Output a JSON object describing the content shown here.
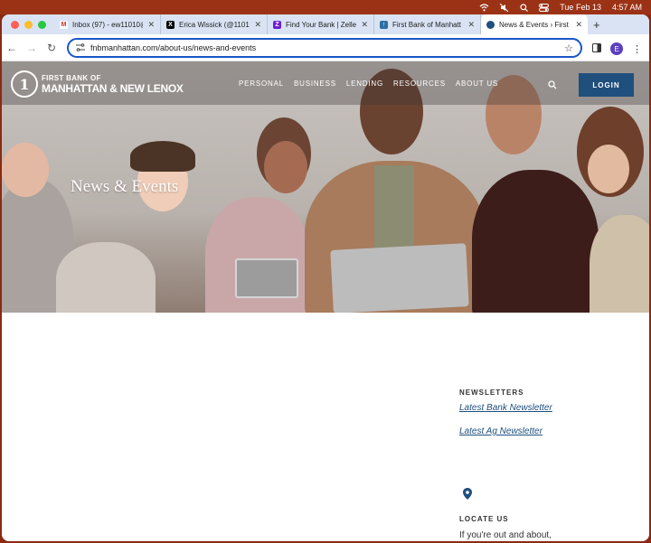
{
  "menubar": {
    "datetime_day": "Tue Feb 13",
    "datetime_time": "4:57 AM"
  },
  "tabs": [
    {
      "title": "Inbox (97) - ew11010@",
      "favicon": "gmail-icon",
      "color": "#d93025"
    },
    {
      "title": "Erica Wissick (@11010",
      "favicon": "x-icon",
      "color": "#000000"
    },
    {
      "title": "Find Your Bank | Zelle",
      "favicon": "zelle-icon",
      "color": "#6d1ed4"
    },
    {
      "title": "First Bank of Manhatt",
      "favicon": "bank-icon",
      "color": "#2d6fa5"
    },
    {
      "title": "News & Events › First",
      "favicon": "bank-icon",
      "color": "#1f4f7d"
    }
  ],
  "address_bar": {
    "url": "fnbmanhattan.com/about-us/news-and-events"
  },
  "profile_initial": "E",
  "site": {
    "logo_line1": "FIRST BANK OF",
    "logo_line2": "MANHATTAN & NEW LENOX",
    "nav": [
      "PERSONAL",
      "BUSINESS",
      "LENDING",
      "RESOURCES",
      "ABOUT US"
    ],
    "login_label": "LOGIN",
    "hero_title": "News & Events"
  },
  "sidebar": {
    "newsletters_heading": "NEWSLETTERS",
    "links": [
      "Latest Bank Newsletter",
      "Latest Ag Newsletter"
    ],
    "locate_heading": "LOCATE US",
    "locate_text": "If you're out and about,"
  },
  "colors": {
    "accent": "#1f4f7d",
    "omnibox_border": "#1a56c8"
  }
}
